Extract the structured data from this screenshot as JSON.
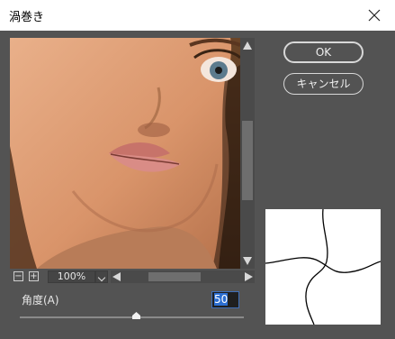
{
  "window": {
    "title": "渦巻き"
  },
  "buttons": {
    "ok": "OK",
    "cancel": "キャンセル"
  },
  "zoom": {
    "minus": "−",
    "plus": "+",
    "value": "100%"
  },
  "angle": {
    "label": "角度(A)",
    "value": "50",
    "slider_fraction": 0.52
  },
  "colors": {
    "dialog_bg": "#535353",
    "selection": "#2c6ed1"
  },
  "icons": [
    "close-icon",
    "zoom-out-icon",
    "zoom-in-icon",
    "chevron-down-icon",
    "scroll-up-icon",
    "scroll-down-icon",
    "scroll-left-icon",
    "scroll-right-icon",
    "slider-thumb-icon"
  ]
}
